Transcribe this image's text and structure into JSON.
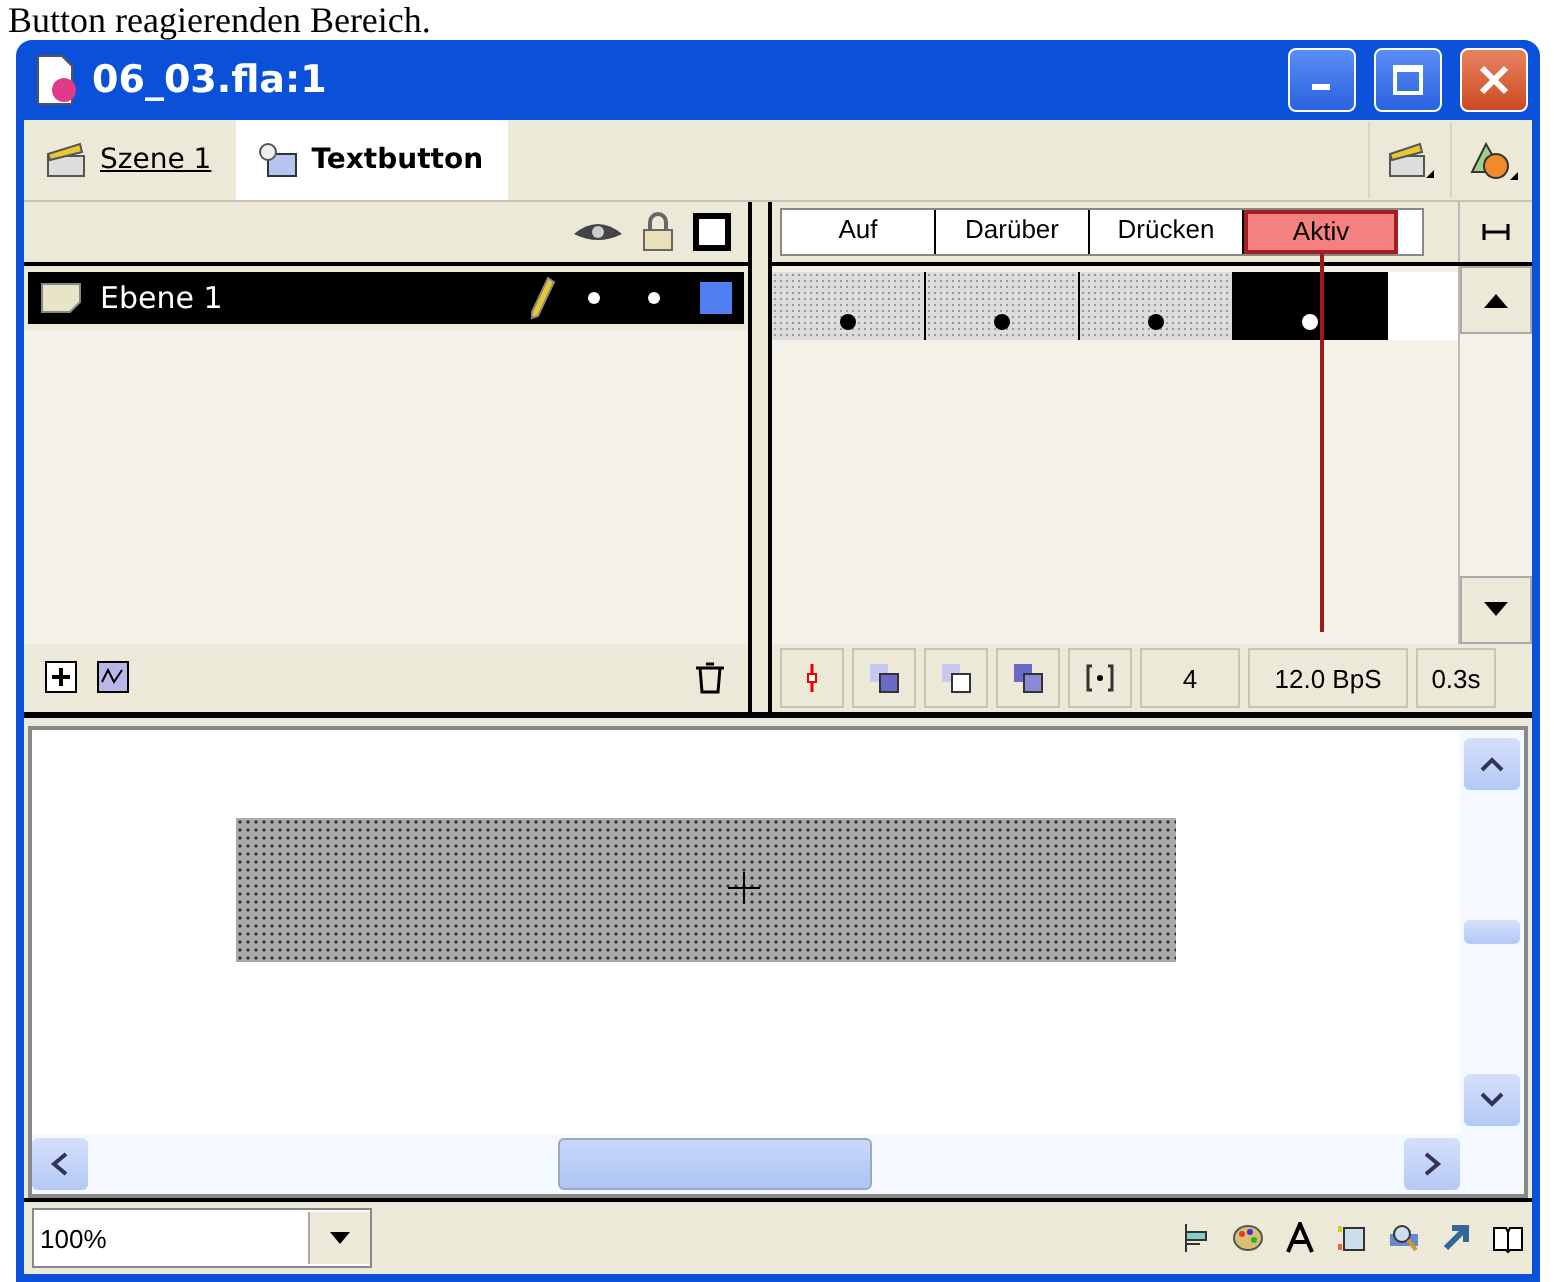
{
  "caption": "Button reagierenden Bereich.",
  "window": {
    "title": "06_03.fla:1"
  },
  "breadcrumbs": [
    {
      "label": "Szene 1",
      "selected": false
    },
    {
      "label": "Textbutton",
      "selected": true
    }
  ],
  "timeline": {
    "layers": [
      {
        "name": "Ebene 1",
        "selected": true,
        "color": "#4f7ff0"
      }
    ],
    "frames": [
      {
        "label": "Auf",
        "selected": false
      },
      {
        "label": "Darüber",
        "selected": false
      },
      {
        "label": "Drücken",
        "selected": false
      },
      {
        "label": "Aktiv",
        "selected": true
      }
    ],
    "current_frame": "4",
    "frame_rate": "12.0 BpS",
    "elapsed": "0.3s"
  },
  "zoom": {
    "value": "100%"
  }
}
